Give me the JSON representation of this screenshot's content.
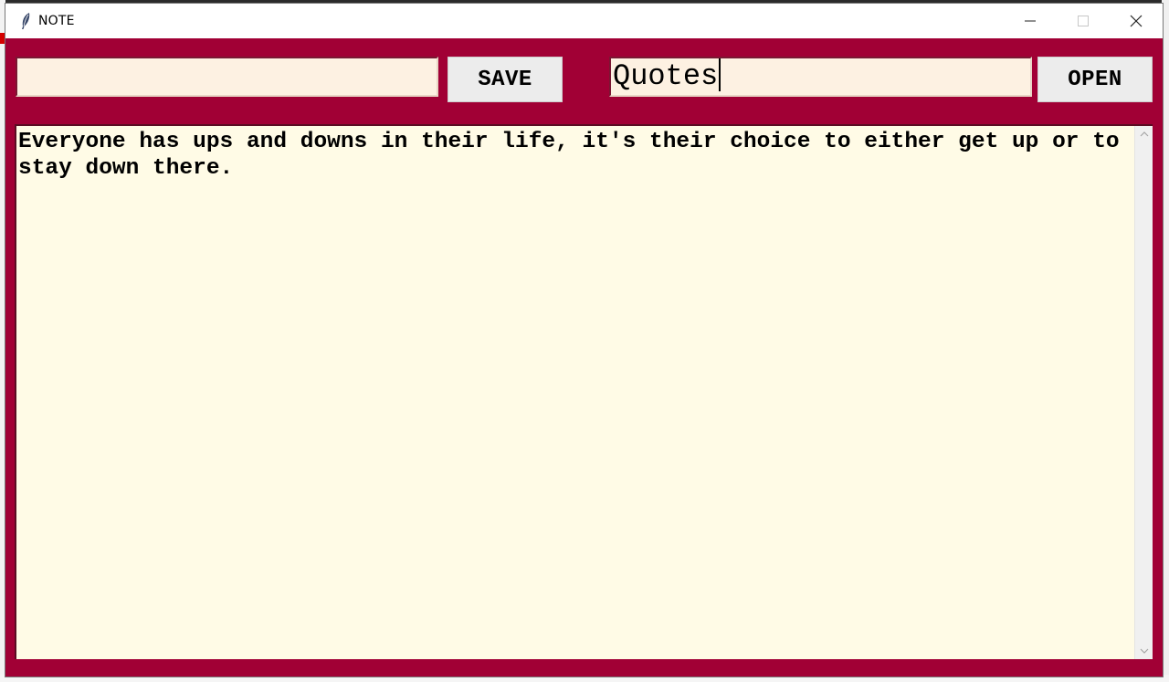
{
  "window": {
    "title": "NOTE",
    "icon": "feather-icon",
    "controls": {
      "minimize": "minimize-icon",
      "maximize": "maximize-icon",
      "close": "close-icon"
    }
  },
  "toolbar": {
    "save_filename_value": "",
    "save_label": "SAVE",
    "open_filename_value": "Quotes",
    "open_label": "OPEN"
  },
  "editor": {
    "content": "Everyone has ups and downs in their life, it's their choice to either get up or to stay down there."
  },
  "colors": {
    "window_background": "#a10035",
    "entry_background": "#fdf1e2",
    "text_area_background": "#fffbe6",
    "button_background": "#ececec"
  }
}
